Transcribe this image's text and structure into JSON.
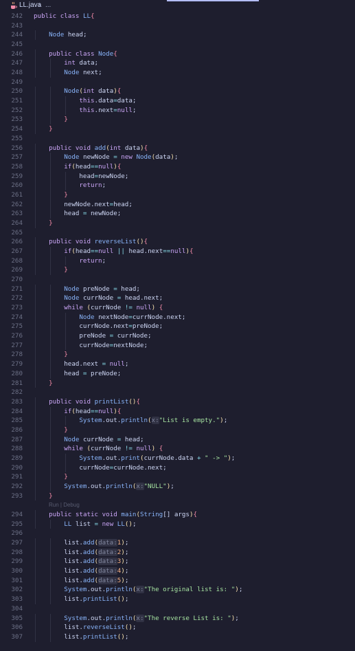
{
  "breadcrumb": {
    "file": "LL.java",
    "rest": "..."
  },
  "editor": {
    "codelens": "Run | Debug",
    "lines": [
      {
        "n": "242",
        "t": "public class LL{"
      },
      {
        "n": "243",
        "t": ""
      },
      {
        "n": "244",
        "t": "    Node head;"
      },
      {
        "n": "245",
        "t": ""
      },
      {
        "n": "246",
        "t": "    public class Node{"
      },
      {
        "n": "247",
        "t": "        int data;"
      },
      {
        "n": "248",
        "t": "        Node next;"
      },
      {
        "n": "249",
        "t": ""
      },
      {
        "n": "250",
        "t": "        Node(int data){"
      },
      {
        "n": "251",
        "t": "            this.data=data;"
      },
      {
        "n": "252",
        "t": "            this.next=null;"
      },
      {
        "n": "253",
        "t": "        }"
      },
      {
        "n": "254",
        "t": "    }"
      },
      {
        "n": "255",
        "t": ""
      },
      {
        "n": "256",
        "t": "    public void add(int data){"
      },
      {
        "n": "257",
        "t": "        Node newNode = new Node(data);"
      },
      {
        "n": "258",
        "t": "        if(head==null){"
      },
      {
        "n": "259",
        "t": "            head=newNode;"
      },
      {
        "n": "260",
        "t": "            return;"
      },
      {
        "n": "261",
        "t": "        }"
      },
      {
        "n": "262",
        "t": "        newNode.next=head;"
      },
      {
        "n": "263",
        "t": "        head = newNode;"
      },
      {
        "n": "264",
        "t": "    }"
      },
      {
        "n": "265",
        "t": ""
      },
      {
        "n": "266",
        "t": "    public void reverseList(){"
      },
      {
        "n": "267",
        "t": "        if(head==null || head.next==null){"
      },
      {
        "n": "268",
        "t": "            return;"
      },
      {
        "n": "269",
        "t": "        }"
      },
      {
        "n": "270",
        "t": ""
      },
      {
        "n": "271",
        "t": "        Node preNode = head;"
      },
      {
        "n": "272",
        "t": "        Node currNode = head.next;"
      },
      {
        "n": "273",
        "t": "        while (currNode != null) {"
      },
      {
        "n": "274",
        "t": "            Node nextNode=currNode.next;"
      },
      {
        "n": "275",
        "t": "            currNode.next=preNode;"
      },
      {
        "n": "276",
        "t": "            preNode = currNode;"
      },
      {
        "n": "277",
        "t": "            currNode=nextNode;"
      },
      {
        "n": "278",
        "t": "        }"
      },
      {
        "n": "279",
        "t": "        head.next = null;"
      },
      {
        "n": "280",
        "t": "        head = preNode;"
      },
      {
        "n": "281",
        "t": "    }"
      },
      {
        "n": "282",
        "t": ""
      },
      {
        "n": "283",
        "t": "    public void printList(){"
      },
      {
        "n": "284",
        "t": "        if(head==null){"
      },
      {
        "n": "285",
        "t": "            System.out.println(x:\"List is empty.\");"
      },
      {
        "n": "286",
        "t": "        }"
      },
      {
        "n": "287",
        "t": "        Node currNode = head;"
      },
      {
        "n": "288",
        "t": "        while (currNode != null) {"
      },
      {
        "n": "289",
        "t": "            System.out.print(currNode.data + \" -> \");"
      },
      {
        "n": "290",
        "t": "            currNode=currNode.next;"
      },
      {
        "n": "291",
        "t": "        }"
      },
      {
        "n": "292",
        "t": "        System.out.println(x:\"NULL\");"
      },
      {
        "n": "293",
        "t": "    }"
      },
      {
        "n": "",
        "t": "CODELENS"
      },
      {
        "n": "294",
        "t": "    public static void main(String[] args){"
      },
      {
        "n": "295",
        "t": "        LL list = new LL();"
      },
      {
        "n": "296",
        "t": ""
      },
      {
        "n": "297",
        "t": "        list.add(data:1);"
      },
      {
        "n": "298",
        "t": "        list.add(data:2);"
      },
      {
        "n": "299",
        "t": "        list.add(data:3);"
      },
      {
        "n": "300",
        "t": "        list.add(data:4);"
      },
      {
        "n": "301",
        "t": "        list.add(data:5);"
      },
      {
        "n": "302",
        "t": "        System.out.println(x:\"The original list is: \");"
      },
      {
        "n": "303",
        "t": "        list.printList();"
      },
      {
        "n": "304",
        "t": ""
      },
      {
        "n": "305",
        "t": "        System.out.println(x:\"The reverse List is: \");"
      },
      {
        "n": "306",
        "t": "        list.reverseList();"
      },
      {
        "n": "307",
        "t": "        list.printList();"
      }
    ]
  },
  "colors": {
    "background": "#1e1e2e",
    "keyword": "#cba6f7",
    "type": "#89b4fa",
    "string": "#a6e3a1",
    "number": "#fab387",
    "operator": "#89dceb",
    "line_number": "#6c7086"
  },
  "icons": {
    "file_type": "java-coffee-icon",
    "separator": "chevron-right-icon"
  }
}
